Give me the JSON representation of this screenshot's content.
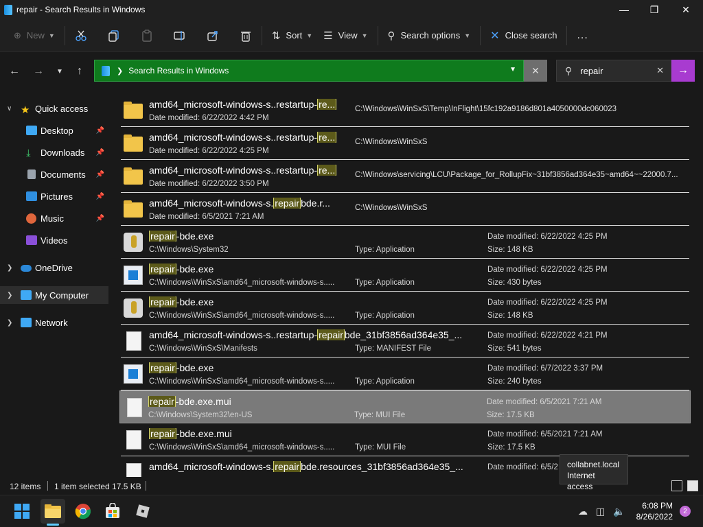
{
  "window": {
    "title": "repair - Search Results in Windows"
  },
  "commandbar": {
    "new_label": "New",
    "sort_label": "Sort",
    "view_label": "View",
    "search_options_label": "Search options",
    "close_search_label": "Close search",
    "more_label": "..."
  },
  "address": {
    "path": "Search Results in Windows"
  },
  "search": {
    "query": "repair"
  },
  "nav": {
    "quick_access": "Quick access",
    "desktop": "Desktop",
    "downloads": "Downloads",
    "documents": "Documents",
    "pictures": "Pictures",
    "music": "Music",
    "videos": "Videos",
    "onedrive": "OneDrive",
    "my_computer": "My Computer",
    "network": "Network"
  },
  "files": [
    {
      "pre": "amd64_microsoft-windows-s..restartup-",
      "hl": "re...",
      "post": "",
      "sub": "Date modified: 6/22/2022 4:42 PM",
      "path": "C:\\Windows\\WinSxS\\Temp\\InFlight\\15fc192a9186d801a4050000dc060023"
    },
    {
      "pre": "amd64_microsoft-windows-s..restartup-",
      "hl": "re...",
      "post": "",
      "sub": "Date modified: 6/22/2022 4:25 PM",
      "path": "C:\\Windows\\WinSxS"
    },
    {
      "pre": "amd64_microsoft-windows-s..restartup-",
      "hl": "re...",
      "post": "",
      "sub": "Date modified: 6/22/2022 3:50 PM",
      "path": "C:\\Windows\\servicing\\LCU\\Package_for_RollupFix~31bf3856ad364e35~amd64~~22000.7..."
    },
    {
      "pre": "amd64_microsoft-windows-s.",
      "hl": "repair",
      "post": "bde.r...",
      "sub": "Date modified: 6/5/2021 7:21 AM",
      "path": "C:\\Windows\\WinSxS"
    },
    {
      "pre": "",
      "hl": "repair",
      "post": "-bde.exe",
      "sub": "C:\\Windows\\System32",
      "type": "Type: Application",
      "date": "Date modified: 6/22/2022 4:25 PM",
      "size": "Size: 148 KB"
    },
    {
      "pre": "",
      "hl": "repair",
      "post": "-bde.exe",
      "sub": "C:\\Windows\\WinSxS\\amd64_microsoft-windows-s.....",
      "type": "Type: Application",
      "date": "Date modified: 6/22/2022 4:25 PM",
      "size": "Size: 430 bytes"
    },
    {
      "pre": "",
      "hl": "repair",
      "post": "-bde.exe",
      "sub": "C:\\Windows\\WinSxS\\amd64_microsoft-windows-s.....",
      "type": "Type: Application",
      "date": "Date modified: 6/22/2022 4:25 PM",
      "size": "Size: 148 KB"
    },
    {
      "pre": "amd64_microsoft-windows-s..restartup-",
      "hl": "repair",
      "post": "bde_31bf3856ad364e35_...",
      "sub": "C:\\Windows\\WinSxS\\Manifests",
      "type": "Type: MANIFEST File",
      "date": "Date modified: 6/22/2022 4:21 PM",
      "size": "Size: 541 bytes"
    },
    {
      "pre": "",
      "hl": "repair",
      "post": "-bde.exe",
      "sub": "C:\\Windows\\WinSxS\\amd64_microsoft-windows-s.....",
      "type": "Type: Application",
      "date": "Date modified: 6/7/2022 3:37 PM",
      "size": "Size: 240 bytes"
    },
    {
      "pre": "",
      "hl": "repair",
      "post": "-bde.exe.mui",
      "sub": "C:\\Windows\\System32\\en-US",
      "type": "Type: MUI File",
      "date": "Date modified: 6/5/2021 7:21 AM",
      "size": "Size: 17.5 KB"
    },
    {
      "pre": "",
      "hl": "repair",
      "post": "-bde.exe.mui",
      "sub": "C:\\Windows\\WinSxS\\amd64_microsoft-windows-s.....",
      "type": "Type: MUI File",
      "date": "Date modified: 6/5/2021 7:21 AM",
      "size": "Size: 17.5 KB"
    },
    {
      "pre": "amd64_microsoft-windows-s.",
      "hl": "repair",
      "post": "bde.resources_31bf3856ad364e35_...",
      "sub": "",
      "type": "",
      "date": "Date modified: 6/5/2",
      "size": ""
    }
  ],
  "status": {
    "count": "12 items",
    "selected": "1 item selected  17.5 KB"
  },
  "tooltip": {
    "line1": "collabnet.local",
    "line2": "Internet access"
  },
  "taskbar": {
    "time": "6:08 PM",
    "date": "8/26/2022",
    "badge": "2"
  }
}
